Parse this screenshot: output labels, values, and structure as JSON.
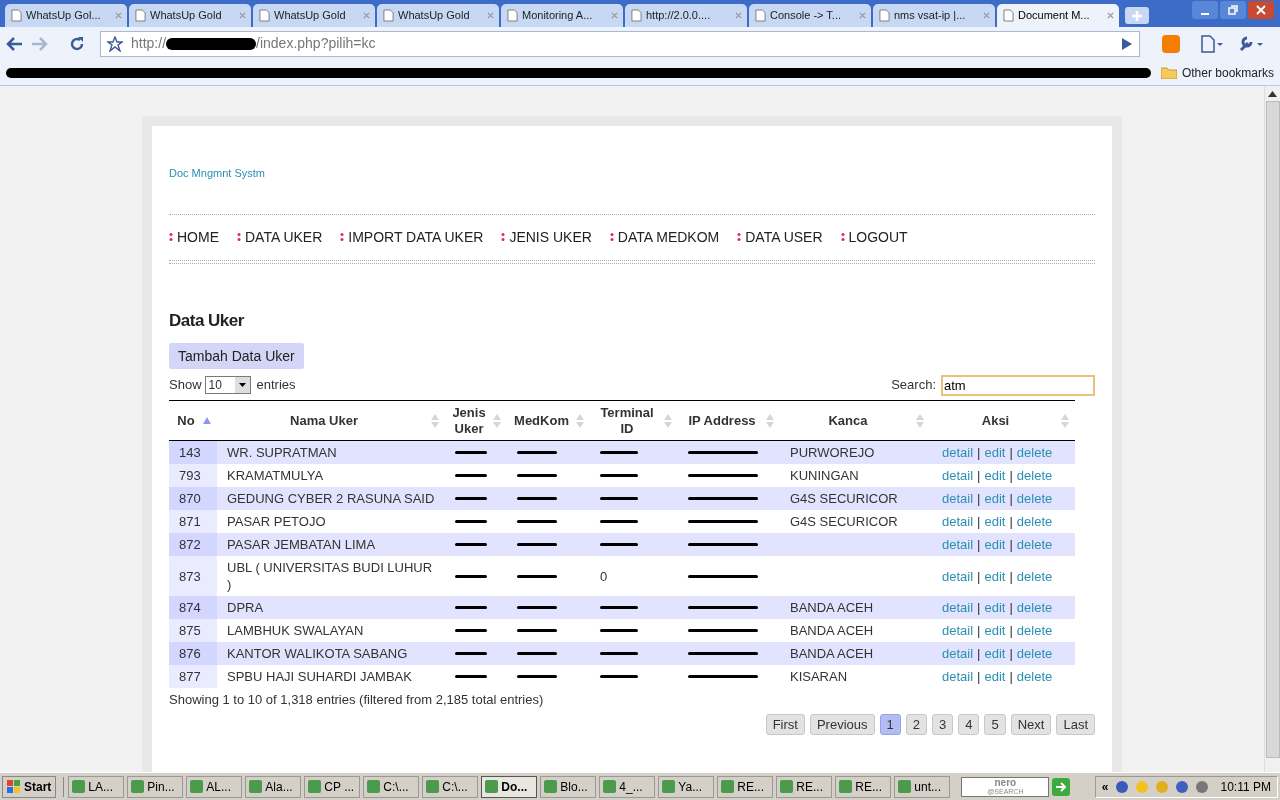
{
  "browser": {
    "tabs": [
      {
        "title": "WhatsUp Gol...",
        "selected": false
      },
      {
        "title": "WhatsUp Gold",
        "selected": false
      },
      {
        "title": "WhatsUp Gold",
        "selected": false
      },
      {
        "title": "WhatsUp Gold",
        "selected": false
      },
      {
        "title": "Monitoring A...",
        "selected": false
      },
      {
        "title": "http://2.0.0....",
        "selected": false
      },
      {
        "title": "Console -> T...",
        "selected": false
      },
      {
        "title": "nms vsat-ip |...",
        "selected": false
      },
      {
        "title": "Document M...",
        "selected": true
      }
    ],
    "address": {
      "scheme": "http://",
      "path": "/index.php?pilih=kc"
    },
    "other_bookmarks": "Other bookmarks"
  },
  "page": {
    "site_title": "Doc Mngmnt Systm",
    "nav": [
      "HOME",
      "DATA UKER",
      "IMPORT DATA UKER",
      "JENIS UKER",
      "DATA MEDKOM",
      "DATA USER",
      "LOGOUT"
    ],
    "heading": "Data Uker",
    "add_button": "Tambah Data Uker",
    "show_label": "Show",
    "page_size": "10",
    "entries_label": "entries",
    "search_label": "Search:",
    "search_value": "atm",
    "columns": [
      {
        "label": "No",
        "sorted": true
      },
      {
        "label": "Nama Uker",
        "sorted": false
      },
      {
        "label": "Jenis Uker",
        "sorted": false
      },
      {
        "label": "MedKom",
        "sorted": false
      },
      {
        "label": "Terminal ID",
        "sorted": false
      },
      {
        "label": "IP Address",
        "sorted": false
      },
      {
        "label": "Kanca",
        "sorted": false
      },
      {
        "label": "Aksi",
        "sorted": false
      }
    ],
    "rows": [
      {
        "cells": [
          {
            "text": "143"
          },
          {
            "text": "WR. SUPRATMAN"
          },
          {
            "redacted": true
          },
          {
            "redacted": true
          },
          {
            "redacted": true
          },
          {
            "redacted": true
          },
          {
            "text": "PURWOREJO"
          }
        ],
        "actions": [
          {
            "kind": "link",
            "text": "detail"
          },
          {
            "kind": "separator",
            "text": "|"
          },
          {
            "kind": "link",
            "text": "edit"
          },
          {
            "kind": "separator",
            "text": "|"
          },
          {
            "kind": "link",
            "text": "delete"
          }
        ]
      },
      {
        "cells": [
          {
            "text": "793"
          },
          {
            "text": "KRAMATMULYA"
          },
          {
            "redacted": true
          },
          {
            "redacted": true
          },
          {
            "redacted": true
          },
          {
            "redacted": true
          },
          {
            "text": "KUNINGAN"
          }
        ],
        "actions": [
          {
            "kind": "link",
            "text": "detail"
          },
          {
            "kind": "separator",
            "text": "|"
          },
          {
            "kind": "link",
            "text": "edit"
          },
          {
            "kind": "separator",
            "text": "|"
          },
          {
            "kind": "link",
            "text": "delete"
          }
        ]
      },
      {
        "cells": [
          {
            "text": "870"
          },
          {
            "text": "GEDUNG CYBER 2 RASUNA SAID"
          },
          {
            "redacted": true
          },
          {
            "redacted": true
          },
          {
            "redacted": true
          },
          {
            "redacted": true
          },
          {
            "text": "G4S SECURICOR"
          }
        ],
        "actions": [
          {
            "kind": "link",
            "text": "detail"
          },
          {
            "kind": "separator",
            "text": "|"
          },
          {
            "kind": "link",
            "text": "edit"
          },
          {
            "kind": "separator",
            "text": "|"
          },
          {
            "kind": "link",
            "text": "delete"
          }
        ]
      },
      {
        "cells": [
          {
            "text": "871"
          },
          {
            "text": "PASAR PETOJO"
          },
          {
            "redacted": true
          },
          {
            "redacted": true
          },
          {
            "redacted": true
          },
          {
            "redacted": true
          },
          {
            "text": "G4S SECURICOR"
          }
        ],
        "actions": [
          {
            "kind": "link",
            "text": "detail"
          },
          {
            "kind": "separator",
            "text": "|"
          },
          {
            "kind": "link",
            "text": "edit"
          },
          {
            "kind": "separator",
            "text": "|"
          },
          {
            "kind": "link",
            "text": "delete"
          }
        ]
      },
      {
        "cells": [
          {
            "text": "872"
          },
          {
            "text": "PASAR JEMBATAN LIMA"
          },
          {
            "redacted": true
          },
          {
            "redacted": true
          },
          {
            "redacted": true
          },
          {
            "redacted": true
          },
          {}
        ],
        "actions": [
          {
            "kind": "link",
            "text": "detail"
          },
          {
            "kind": "separator",
            "text": "|"
          },
          {
            "kind": "link",
            "text": "edit"
          },
          {
            "kind": "separator",
            "text": "|"
          },
          {
            "kind": "link",
            "text": "delete"
          }
        ]
      },
      {
        "cells": [
          {
            "text": "873"
          },
          {
            "text": "UBL ( UNIVERSITAS BUDI LUHUR )"
          },
          {
            "redacted": true
          },
          {
            "redacted": true
          },
          {
            "text": "0"
          },
          {
            "redacted": true
          },
          {}
        ],
        "actions": [
          {
            "kind": "link",
            "text": "detail"
          },
          {
            "kind": "separator",
            "text": "|"
          },
          {
            "kind": "link",
            "text": "edit"
          },
          {
            "kind": "separator",
            "text": "|"
          },
          {
            "kind": "link",
            "text": "delete"
          }
        ]
      },
      {
        "cells": [
          {
            "text": "874"
          },
          {
            "text": "DPRA"
          },
          {
            "redacted": true
          },
          {
            "redacted": true
          },
          {
            "redacted": true
          },
          {
            "redacted": true
          },
          {
            "text": "BANDA ACEH"
          }
        ],
        "actions": [
          {
            "kind": "link",
            "text": "detail"
          },
          {
            "kind": "separator",
            "text": "|"
          },
          {
            "kind": "link",
            "text": "edit"
          },
          {
            "kind": "separator",
            "text": "|"
          },
          {
            "kind": "link",
            "text": "delete"
          }
        ]
      },
      {
        "cells": [
          {
            "text": "875"
          },
          {
            "text": "LAMBHUK SWALAYAN"
          },
          {
            "redacted": true
          },
          {
            "redacted": true
          },
          {
            "redacted": true
          },
          {
            "redacted": true
          },
          {
            "text": "BANDA ACEH"
          }
        ],
        "actions": [
          {
            "kind": "link",
            "text": "detail"
          },
          {
            "kind": "separator",
            "text": "|"
          },
          {
            "kind": "link",
            "text": "edit"
          },
          {
            "kind": "separator",
            "text": "|"
          },
          {
            "kind": "link",
            "text": "delete"
          }
        ]
      },
      {
        "cells": [
          {
            "text": "876"
          },
          {
            "text": "KANTOR WALIKOTA SABANG"
          },
          {
            "redacted": true
          },
          {
            "redacted": true
          },
          {
            "redacted": true
          },
          {
            "redacted": true
          },
          {
            "text": "BANDA ACEH"
          }
        ],
        "actions": [
          {
            "kind": "link",
            "text": "detail"
          },
          {
            "kind": "separator",
            "text": "|"
          },
          {
            "kind": "link",
            "text": "edit"
          },
          {
            "kind": "separator",
            "text": "|"
          },
          {
            "kind": "link",
            "text": "delete"
          }
        ]
      },
      {
        "cells": [
          {
            "text": "877"
          },
          {
            "text": "SPBU HAJI SUHARDI JAMBAK"
          },
          {
            "redacted": true
          },
          {
            "redacted": true
          },
          {
            "redacted": true
          },
          {
            "redacted": true
          },
          {
            "text": "KISARAN"
          }
        ],
        "actions": [
          {
            "kind": "link",
            "text": "detail"
          },
          {
            "kind": "separator",
            "text": "|"
          },
          {
            "kind": "link",
            "text": "edit"
          },
          {
            "kind": "separator",
            "text": "|"
          },
          {
            "kind": "link",
            "text": "delete"
          }
        ]
      }
    ],
    "info": "Showing 1 to 10 of 1,318 entries (filtered from 2,185 total entries)",
    "pagination": [
      {
        "label": "First",
        "selected": false
      },
      {
        "label": "Previous",
        "selected": false
      },
      {
        "label": "1",
        "selected": true
      },
      {
        "label": "2",
        "selected": false
      },
      {
        "label": "3",
        "selected": false
      },
      {
        "label": "4",
        "selected": false
      },
      {
        "label": "5",
        "selected": false
      },
      {
        "label": "Next",
        "selected": false
      },
      {
        "label": "Last",
        "selected": false
      }
    ]
  },
  "taskbar": {
    "start": "Start",
    "items": [
      {
        "label": "LA...",
        "selected": false
      },
      {
        "label": "Pin...",
        "selected": false
      },
      {
        "label": "AL...",
        "selected": false
      },
      {
        "label": "Ala...",
        "selected": false
      },
      {
        "label": "CP ...",
        "selected": false
      },
      {
        "label": "C:\\...",
        "selected": false
      },
      {
        "label": "C:\\...",
        "selected": false
      },
      {
        "label": "Do...",
        "selected": true
      },
      {
        "label": "Blo...",
        "selected": false
      },
      {
        "label": "4_...",
        "selected": false
      },
      {
        "label": "Ya...",
        "selected": false
      },
      {
        "label": "RE...",
        "selected": false
      },
      {
        "label": "RE...",
        "selected": false
      },
      {
        "label": "RE...",
        "selected": false
      },
      {
        "label": "unt...",
        "selected": false
      }
    ],
    "search_logo": "nero",
    "search_sub": "@SEARCH",
    "tray_toggle": "«",
    "clock": "10:11 PM"
  }
}
